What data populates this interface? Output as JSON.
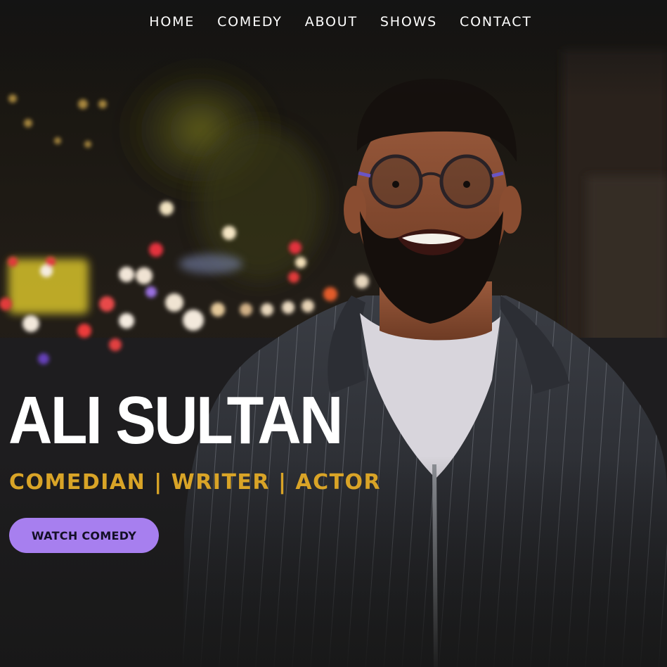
{
  "nav": {
    "items": [
      {
        "label": "HOME"
      },
      {
        "label": "COMEDY"
      },
      {
        "label": "ABOUT"
      },
      {
        "label": "SHOWS"
      },
      {
        "label": "CONTACT"
      }
    ]
  },
  "hero": {
    "name": "ALI SULTAN",
    "tagline": "COMEDIAN | WRITER | ACTOR",
    "cta_label": "WATCH COMEDY"
  },
  "colors": {
    "nav_text": "#ffffff",
    "name_text": "#ffffff",
    "tagline_text": "#d9a427",
    "cta_background": "#a77fef",
    "cta_text": "#141026",
    "background": "#141414"
  }
}
